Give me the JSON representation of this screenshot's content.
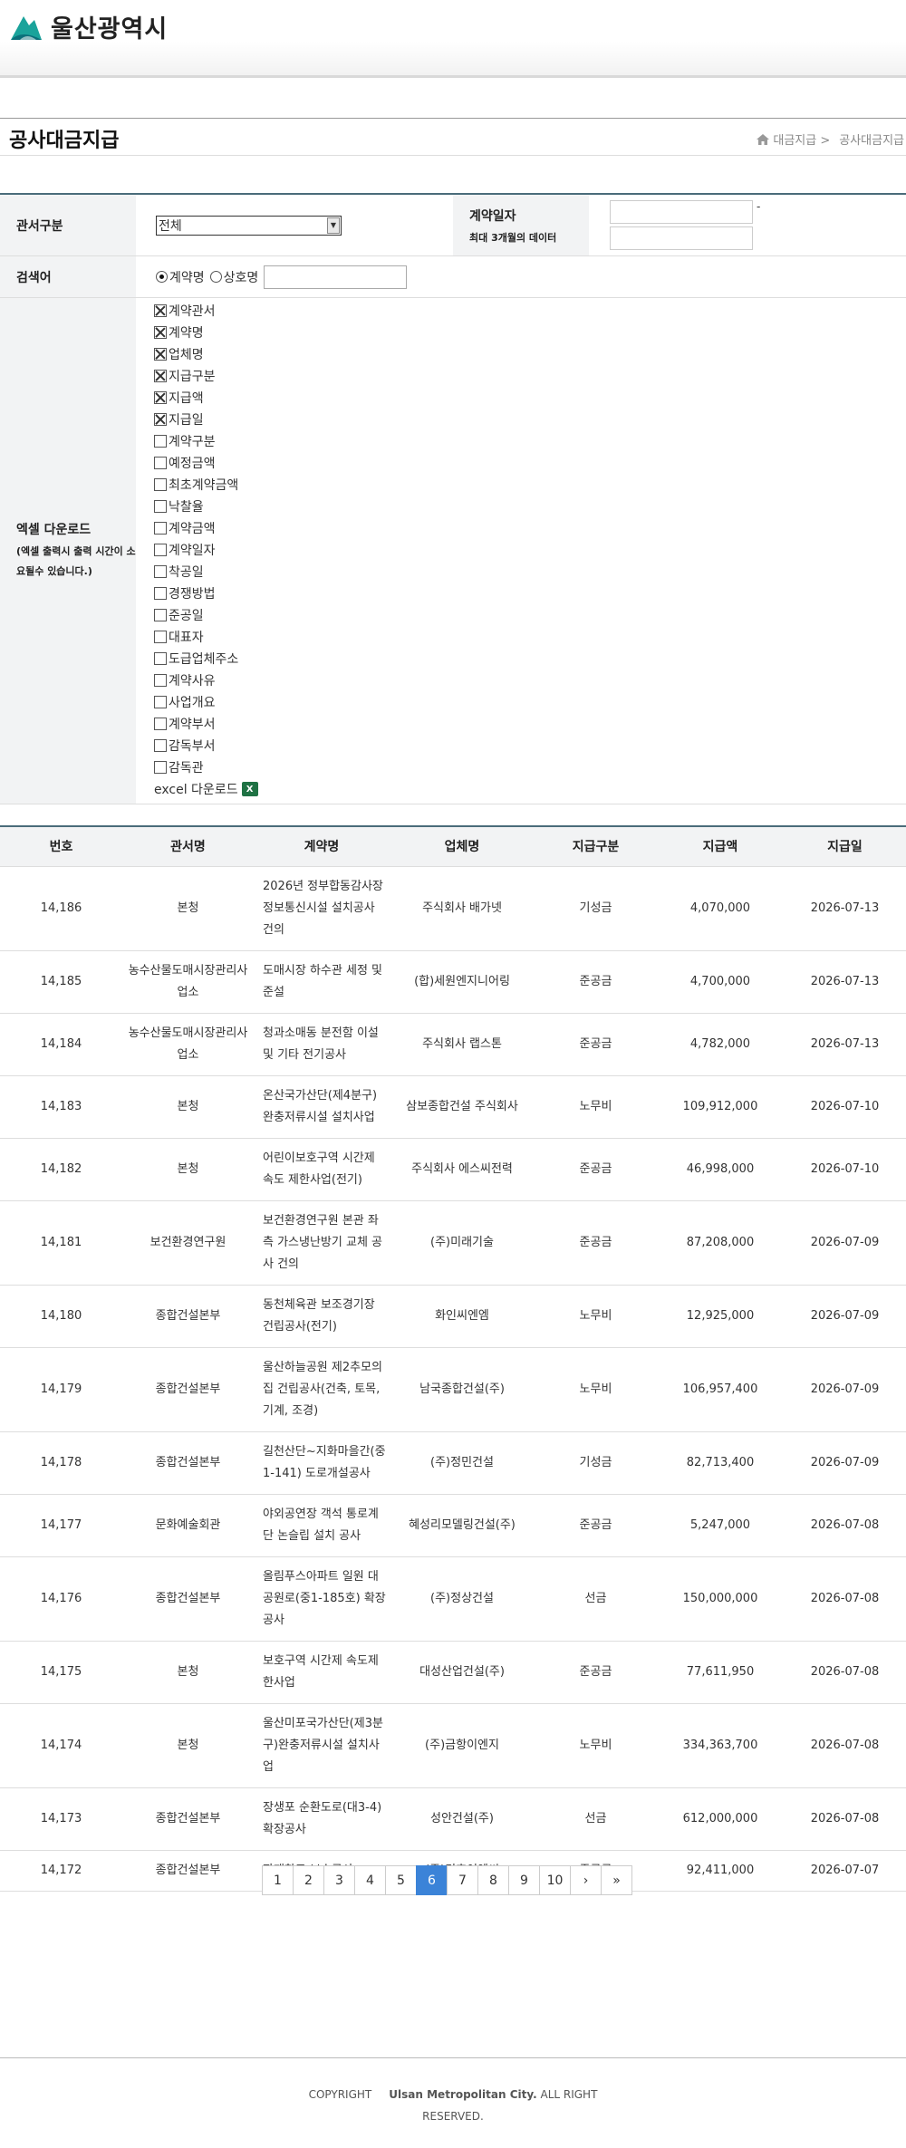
{
  "header": {
    "logo_text": "울산광역시",
    "brand_color": "#1aa39b"
  },
  "page": {
    "title": "공사대금지급",
    "breadcrumb": [
      "대금지급 >",
      "공사대금지급"
    ]
  },
  "form": {
    "office_label": "관서구분",
    "office_selected": "전체",
    "date_label": "계약일자",
    "date_note": "최대 3개월의 데이터",
    "date_sep": "-",
    "search_label": "검색어",
    "search_options": [
      "계약명",
      "상호명"
    ],
    "search_selected": "계약명",
    "search_value": "",
    "excel_label": "엑셀 다운로드",
    "excel_note": "(엑셀 출력시 출력 시간이 소요될수 있습니다.)",
    "excel_fields": [
      {
        "label": "계약관서",
        "checked": true
      },
      {
        "label": "계약명",
        "checked": true
      },
      {
        "label": "업체명",
        "checked": true
      },
      {
        "label": "지급구분",
        "checked": true
      },
      {
        "label": "지급액",
        "checked": true
      },
      {
        "label": "지급일",
        "checked": true
      },
      {
        "label": "계약구분",
        "checked": false
      },
      {
        "label": "예정금액",
        "checked": false
      },
      {
        "label": "최초계약금액",
        "checked": false
      },
      {
        "label": "낙찰율",
        "checked": false
      },
      {
        "label": "계약금액",
        "checked": false
      },
      {
        "label": "계약일자",
        "checked": false
      },
      {
        "label": "착공일",
        "checked": false
      },
      {
        "label": "경쟁방법",
        "checked": false
      },
      {
        "label": "준공일",
        "checked": false
      },
      {
        "label": "대표자",
        "checked": false
      },
      {
        "label": "도급업체주소",
        "checked": false
      },
      {
        "label": "계약사유",
        "checked": false
      },
      {
        "label": "사업개요",
        "checked": false
      },
      {
        "label": "계약부서",
        "checked": false
      },
      {
        "label": "감독부서",
        "checked": false
      },
      {
        "label": "감독관",
        "checked": false
      }
    ],
    "excel_download": "excel 다운로드",
    "excel_icon": "excel-icon"
  },
  "table": {
    "headers": [
      "번호",
      "관서명",
      "계약명",
      "업체명",
      "지급구분",
      "지급액",
      "지급일"
    ],
    "rows": [
      [
        "14,186",
        "본청",
        "2026년 정부합동감사장 정보통신시설 설치공사 건의",
        "주식회사 배가넷",
        "기성금",
        "4,070,000",
        "2026-07-13"
      ],
      [
        "14,185",
        "농수산물도매시장관리사업소",
        "도매시장 하수관 세정 및 준설",
        "(합)세원엔지니어링",
        "준공금",
        "4,700,000",
        "2026-07-13"
      ],
      [
        "14,184",
        "농수산물도매시장관리사업소",
        "청과소매동 분전함 이설 및 기타 전기공사",
        "주식회사 랩스톤",
        "준공금",
        "4,782,000",
        "2026-07-13"
      ],
      [
        "14,183",
        "본청",
        "온산국가산단(제4분구)완충저류시설 설치사업",
        "삼보종합건설 주식회사",
        "노무비",
        "109,912,000",
        "2026-07-10"
      ],
      [
        "14,182",
        "본청",
        "어린이보호구역 시간제 속도 제한사업(전기)",
        "주식회사 에스씨전력",
        "준공금",
        "46,998,000",
        "2026-07-10"
      ],
      [
        "14,181",
        "보건환경연구원",
        "보건환경연구원 본관 좌측 가스냉난방기 교체 공사 건의",
        "(주)미래기술",
        "준공금",
        "87,208,000",
        "2026-07-09"
      ],
      [
        "14,180",
        "종합건설본부",
        "동천체육관 보조경기장 건립공사(전기)",
        "화인씨엔엠",
        "노무비",
        "12,925,000",
        "2026-07-09"
      ],
      [
        "14,179",
        "종합건설본부",
        "울산하늘공원 제2추모의집 건립공사(건축, 토목, 기계, 조경)",
        "남국종합건설(주)",
        "노무비",
        "106,957,400",
        "2026-07-09"
      ],
      [
        "14,178",
        "종합건설본부",
        "길천산단~지화마을간(중1-141) 도로개설공사",
        "(주)정민건설",
        "기성금",
        "82,713,400",
        "2026-07-09"
      ],
      [
        "14,177",
        "문화예술회관",
        "야외공연장 객석 통로계단 논슬립 설치 공사",
        "혜성리모델링건설(주)",
        "준공금",
        "5,247,000",
        "2026-07-08"
      ],
      [
        "14,176",
        "종합건설본부",
        "올림푸스아파트 일원 대공원로(중1-185호) 확장공사",
        "(주)정상건설",
        "선금",
        "150,000,000",
        "2026-07-08"
      ],
      [
        "14,175",
        "본청",
        "보호구역 시간제 속도제한사업",
        "대성산업건설(주)",
        "준공금",
        "77,611,950",
        "2026-07-08"
      ],
      [
        "14,174",
        "본청",
        "울산미포국가산단(제3분구)완충저류시설 설치사업",
        "(주)금항이엔지",
        "노무비",
        "334,363,700",
        "2026-07-08"
      ],
      [
        "14,173",
        "종합건설본부",
        "장생포 순환도로(대3-4) 확장공사",
        "성안건설(주)",
        "선금",
        "612,000,000",
        "2026-07-08"
      ],
      [
        "14,172",
        "종합건설본부",
        "자재창고 보수공사",
        "(주)건호이엔씨",
        "준공금",
        "92,411,000",
        "2026-07-07"
      ]
    ]
  },
  "pagination": {
    "pages": [
      "1",
      "2",
      "3",
      "4",
      "5",
      "6",
      "7",
      "8",
      "9",
      "10"
    ],
    "current": "6",
    "next": "›",
    "last": "»",
    "active_color": "#3b83d8"
  },
  "footer": {
    "copyright_prefix": "COPYRIGHT",
    "org": "Ulsan Metropolitan City.",
    "rights_line1": "ALL RIGHT",
    "rights_line2": "RESERVED."
  }
}
